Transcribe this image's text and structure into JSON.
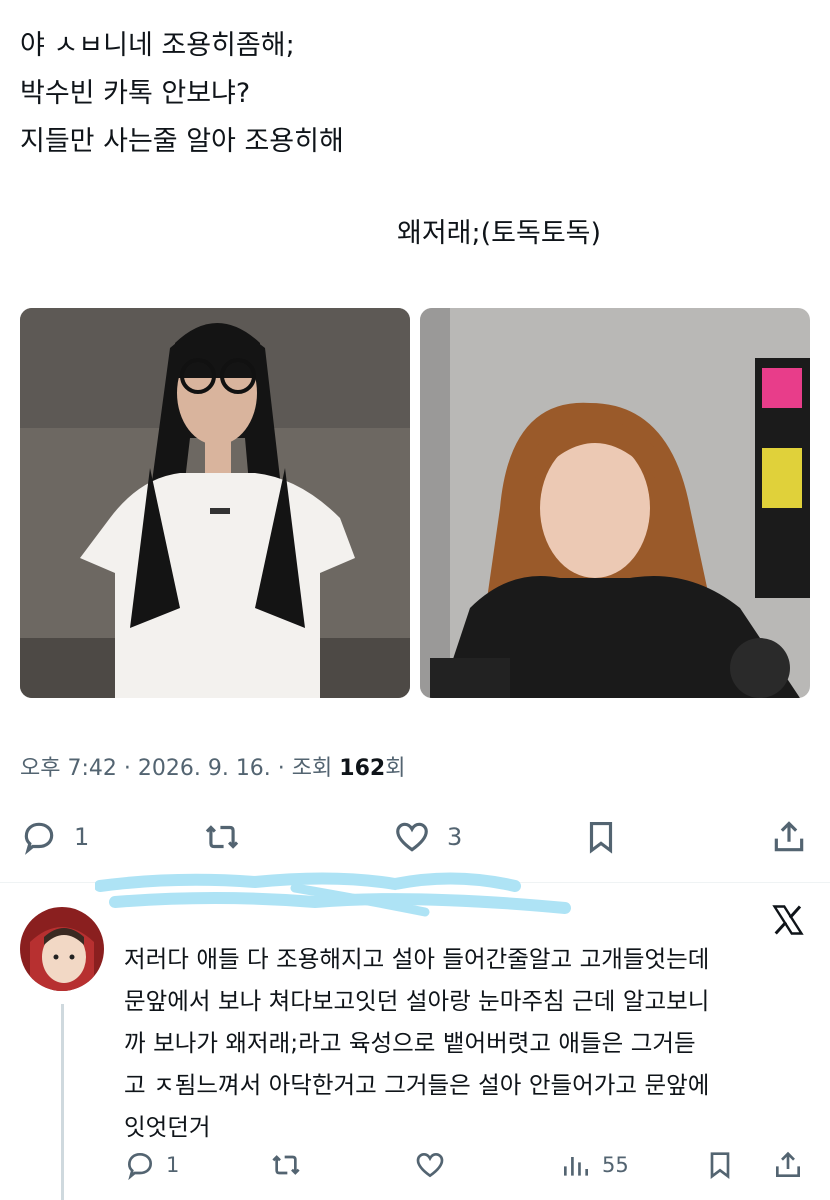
{
  "tweet": {
    "lines": [
      "야 ㅅㅂ니네 조용히좀해;",
      "박수빈 카톡 안보냐?",
      "지들만 사는줄 알아 조용히해"
    ],
    "right_line": "왜저래;(토독토독)"
  },
  "meta": {
    "time_date_prefix": "오후 7:42 · 2026. 9. 16. · 조회 ",
    "views": "162",
    "views_suffix": "회"
  },
  "actions": {
    "reply_count": "1",
    "retweet_count": "",
    "like_count": "3"
  },
  "reply": {
    "lines": [
      "저러다 애들 다 조용해지고 설아 들어간줄알고 고개들엇는데",
      "문앞에서 보나 쳐다보고잇던 설아랑 눈마주침 근데 알고보니",
      "까 보나가 왜저래;라고 육성으로 뱉어버렷고 애들은 그거듣",
      "고 ㅈ됨느껴서 아닥한거고 그거들은 설아 안들어가고 문앞에",
      "잇엇던거"
    ],
    "reply_count": "1",
    "retweet_count": "",
    "like_count": "",
    "views_count": "55"
  },
  "icons": {
    "reply": "speech-bubble-icon",
    "retweet": "retweet-icon",
    "like": "heart-icon",
    "bookmark": "bookmark-icon",
    "share": "share-icon",
    "views": "bar-chart-icon",
    "brand": "x-logo-icon"
  },
  "colors": {
    "icon_gray": "#536471",
    "text": "#0f1419",
    "redaction": "#aee3f5"
  }
}
